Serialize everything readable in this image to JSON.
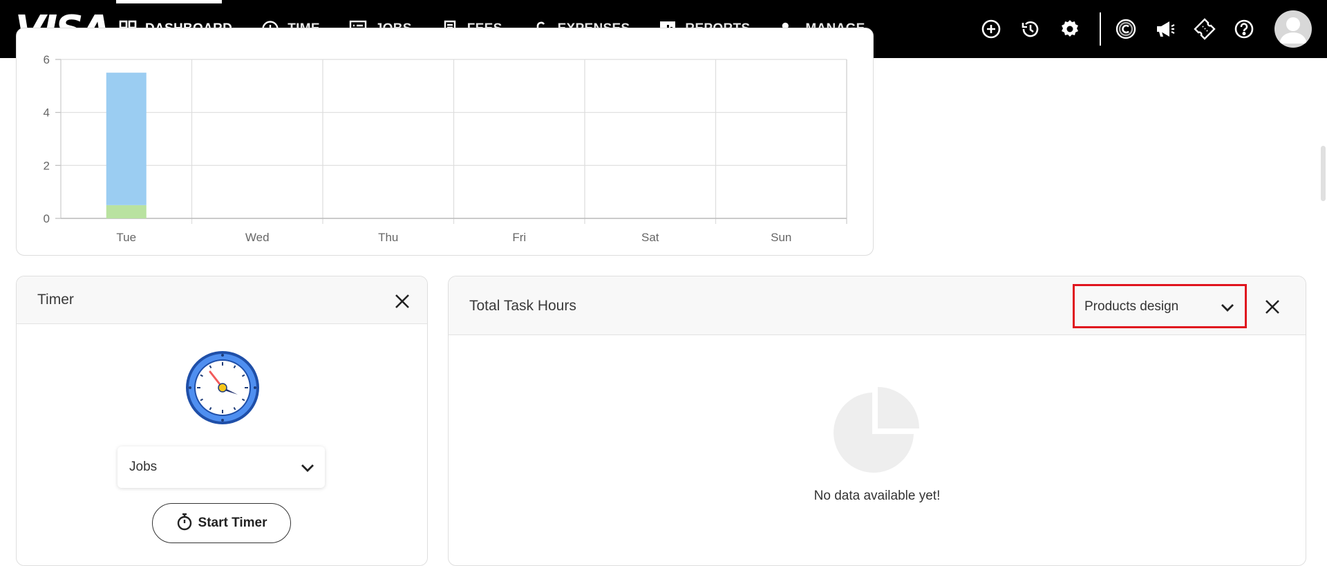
{
  "brand": {
    "logo_text": "VISA"
  },
  "nav": {
    "items": [
      {
        "label": "DASHBOARD",
        "icon": "dashboard-grid-icon",
        "active": true
      },
      {
        "label": "TIME",
        "icon": "clock-icon"
      },
      {
        "label": "JOBS",
        "icon": "list-icon"
      },
      {
        "label": "FEES",
        "icon": "receipt-icon"
      },
      {
        "label": "EXPENSES",
        "icon": "pound-icon"
      },
      {
        "label": "REPORTS",
        "icon": "bar-report-icon"
      },
      {
        "label": "MANAGE",
        "icon": "user-gear-icon"
      }
    ]
  },
  "toolbar": {
    "icons": [
      "add-circle-icon",
      "history-icon",
      "settings-gear-icon",
      "copyright-c-icon",
      "megaphone-icon",
      "ticket-icon",
      "help-icon",
      "user-avatar-icon"
    ]
  },
  "chart_data": {
    "type": "bar",
    "stacked": true,
    "categories": [
      "Tue",
      "Wed",
      "Thu",
      "Fri",
      "Sat",
      "Sun"
    ],
    "series": [
      {
        "values": [
          0.5,
          0,
          0,
          0,
          0,
          0
        ],
        "color": "#b9e2a0"
      },
      {
        "values": [
          5.0,
          0,
          0,
          0,
          0,
          0
        ],
        "color": "#9bcdf2"
      }
    ],
    "y_ticks": [
      0,
      2,
      4,
      6
    ],
    "ylim": [
      0,
      6
    ],
    "grid": true,
    "title": "",
    "xlabel": "",
    "ylabel": ""
  },
  "timer": {
    "title": "Timer",
    "jobs_select": "Jobs",
    "start_label": "Start Timer"
  },
  "task_hours": {
    "title": "Total Task Hours",
    "project_select": "Products design",
    "empty_message": "No data available yet!"
  },
  "colors": {
    "topbar": "#000000",
    "highlight_border": "#e0141e",
    "clock_ring": "#3d7be0"
  }
}
